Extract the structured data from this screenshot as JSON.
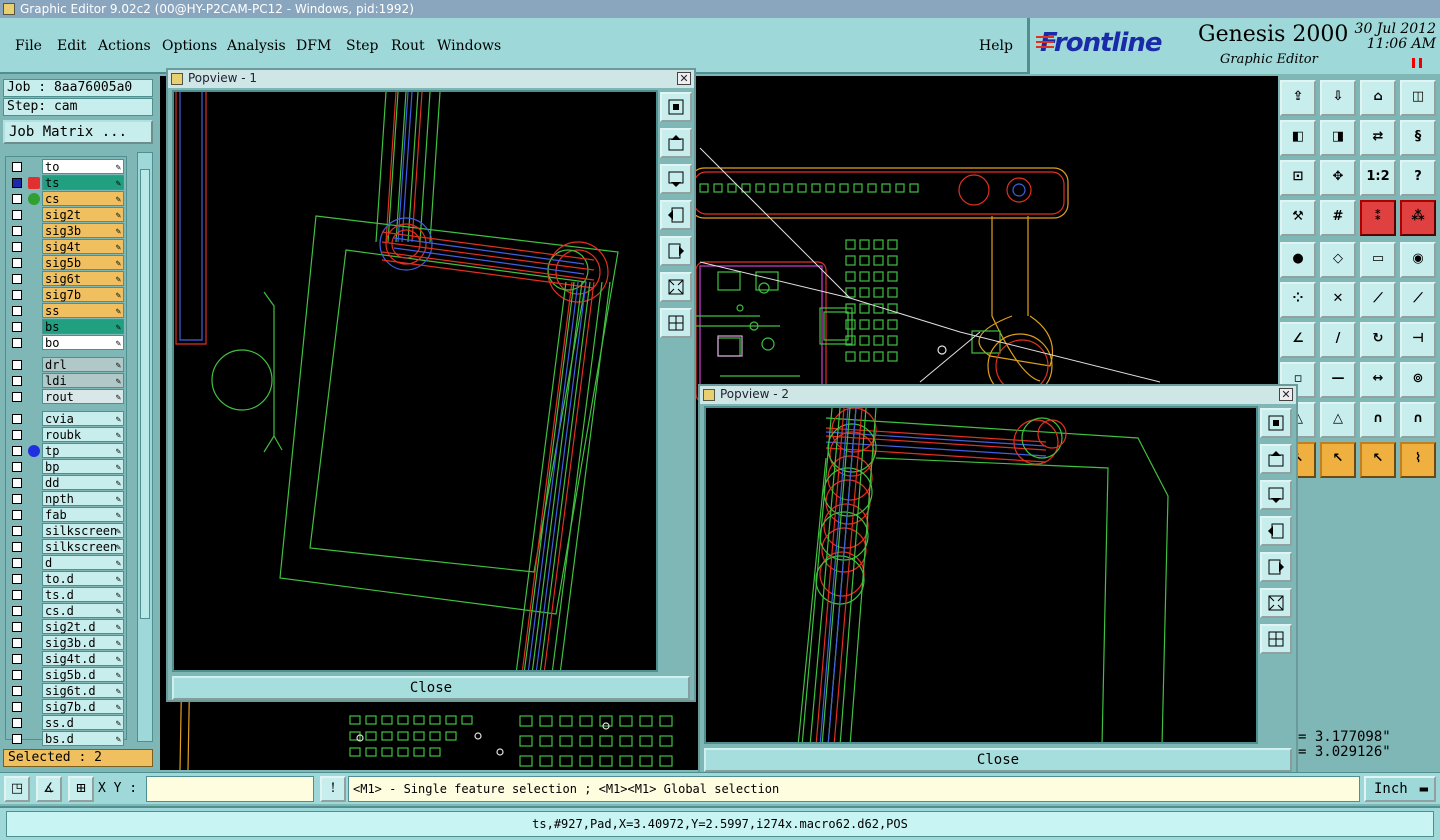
{
  "window": {
    "title": "Graphic Editor 9.02c2 (00@HY-P2CAM-PC12 - Windows, pid:1992)"
  },
  "menu": {
    "items": [
      "File",
      "Edit",
      "Actions",
      "Options",
      "Analysis",
      "DFM",
      "Step",
      "Rout",
      "Windows"
    ],
    "help": "Help"
  },
  "brand": {
    "logo": "Frontline",
    "product": "Genesis 2000",
    "subtitle": "Graphic Editor",
    "date": "30 Jul 2012",
    "time": "11:06 AM"
  },
  "job": {
    "label": "Job : 8aa76005a0",
    "step": "Step: cam",
    "matrix_button": "Job Matrix ..."
  },
  "layers": [
    {
      "name": "to",
      "color": "#ffffff",
      "mark": ""
    },
    {
      "name": "ts",
      "color": "#20a080",
      "mark": "edit",
      "checked": true
    },
    {
      "name": "cs",
      "color": "#f0c060",
      "mark": "green"
    },
    {
      "name": "sig2t",
      "color": "#f0c060",
      "mark": ""
    },
    {
      "name": "sig3b",
      "color": "#f0c060",
      "mark": ""
    },
    {
      "name": "sig4t",
      "color": "#f0c060",
      "mark": ""
    },
    {
      "name": "sig5b",
      "color": "#f0c060",
      "mark": ""
    },
    {
      "name": "sig6t",
      "color": "#f0c060",
      "mark": ""
    },
    {
      "name": "sig7b",
      "color": "#f0c060",
      "mark": ""
    },
    {
      "name": "ss",
      "color": "#f0c060",
      "mark": ""
    },
    {
      "name": "bs",
      "color": "#20a080",
      "mark": ""
    },
    {
      "name": "bo",
      "color": "#ffffff",
      "mark": ""
    },
    {
      "name": "drl",
      "color": "#b0c8c8",
      "mark": ""
    },
    {
      "name": "ldi",
      "color": "#b0c8c8",
      "mark": ""
    },
    {
      "name": "rout",
      "color": "#d8e8e8",
      "mark": ""
    },
    {
      "name": "cvia",
      "color": "#c8eded",
      "mark": ""
    },
    {
      "name": "roubk",
      "color": "#c8eded",
      "mark": ""
    },
    {
      "name": "tp",
      "color": "#c8eded",
      "mark": "blue"
    },
    {
      "name": "bp",
      "color": "#c8eded",
      "mark": ""
    },
    {
      "name": "dd",
      "color": "#c8eded",
      "mark": ""
    },
    {
      "name": "npth",
      "color": "#c8eded",
      "mark": ""
    },
    {
      "name": "fab",
      "color": "#c8eded",
      "mark": ""
    },
    {
      "name": "silkscreen",
      "color": "#c8eded",
      "mark": ""
    },
    {
      "name": "silkscreen",
      "color": "#c8eded",
      "mark": ""
    },
    {
      "name": "d",
      "color": "#c8eded",
      "mark": ""
    },
    {
      "name": "to.d",
      "color": "#c8eded",
      "mark": ""
    },
    {
      "name": "ts.d",
      "color": "#c8eded",
      "mark": ""
    },
    {
      "name": "cs.d",
      "color": "#c8eded",
      "mark": ""
    },
    {
      "name": "sig2t.d",
      "color": "#c8eded",
      "mark": ""
    },
    {
      "name": "sig3b.d",
      "color": "#c8eded",
      "mark": ""
    },
    {
      "name": "sig4t.d",
      "color": "#c8eded",
      "mark": ""
    },
    {
      "name": "sig5b.d",
      "color": "#c8eded",
      "mark": ""
    },
    {
      "name": "sig6t.d",
      "color": "#c8eded",
      "mark": ""
    },
    {
      "name": "sig7b.d",
      "color": "#c8eded",
      "mark": ""
    },
    {
      "name": "ss.d",
      "color": "#c8eded",
      "mark": ""
    },
    {
      "name": "bs.d",
      "color": "#c8eded",
      "mark": ""
    }
  ],
  "selected": "Selected : 2",
  "popup1": {
    "title": "Popview - 1",
    "close_label": "Close"
  },
  "popup2": {
    "title": "Popview - 2",
    "close_label": "Close"
  },
  "coords": {
    "x": "= 3.177098\"",
    "y": "= 3.029126\""
  },
  "bottom": {
    "xy_label": "X Y :",
    "xy_value": "",
    "message": "<M1> - Single feature selection ; <M1><M1> Global selection",
    "unit": "Inch"
  },
  "status": "ts,#927,Pad,X=3.40972,Y=2.5997,i274x.macro62.d62,POS",
  "toolbar_labels": {
    "one_to_two": "1:2",
    "help": "?"
  }
}
